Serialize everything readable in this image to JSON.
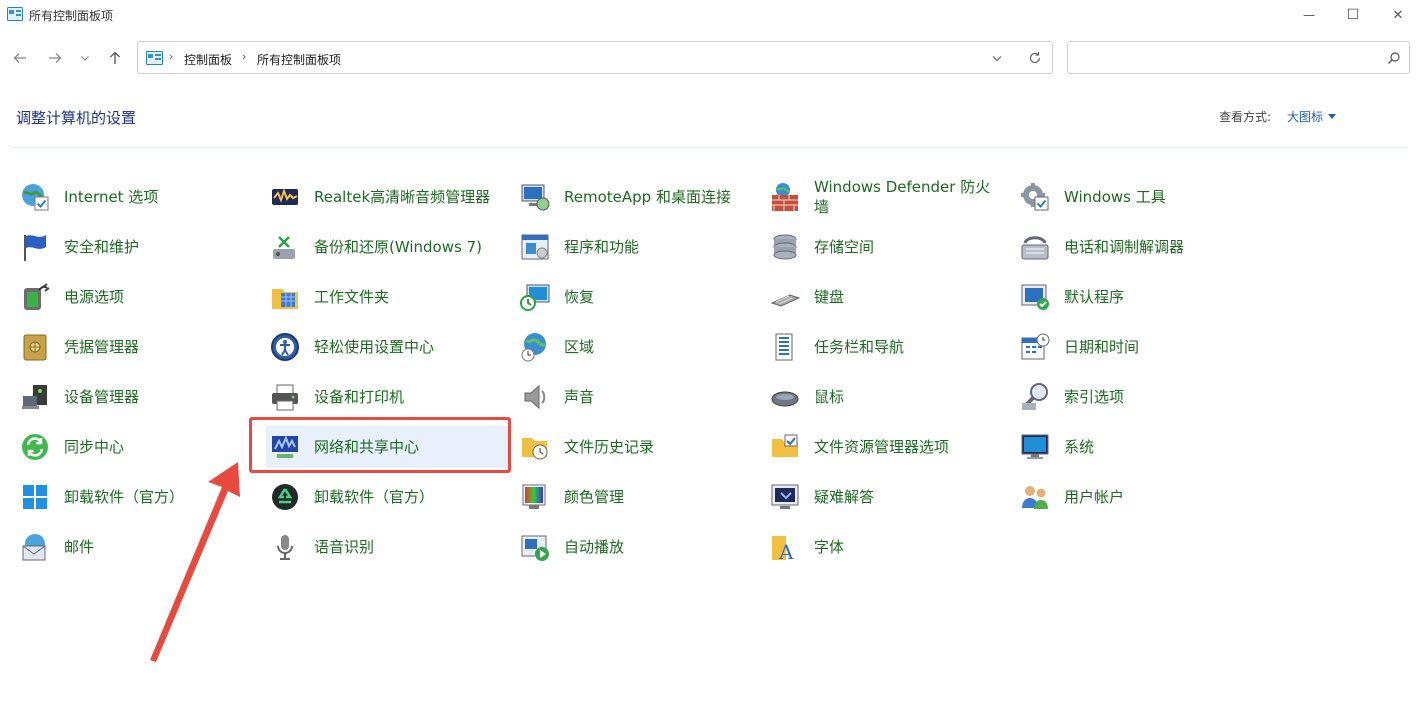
{
  "window": {
    "title": "所有控制面板项",
    "controls": {
      "minimize": "—",
      "maximize": "☐",
      "close": "✕"
    }
  },
  "nav": {
    "breadcrumb": [
      "控制面板",
      "所有控制面板项"
    ],
    "search_placeholder": ""
  },
  "header": {
    "title": "调整计算机的设置",
    "view_label": "查看方式:",
    "view_value": "大图标"
  },
  "highlight": {
    "item": "网络和共享中心",
    "color": "#e94a3f"
  },
  "items": [
    [
      "Internet 选项",
      "安全和维护",
      "电源选项",
      "凭据管理器",
      "设备管理器",
      "同步中心",
      "卸载软件（官方）",
      "邮件"
    ],
    [
      "Realtek高清晰音频管理器",
      "备份和还原(Windows 7)",
      "工作文件夹",
      "轻松使用设置中心",
      "设备和打印机",
      "网络和共享中心",
      "卸载软件（官方）",
      "语音识别"
    ],
    [
      "RemoteApp 和桌面连接",
      "程序和功能",
      "恢复",
      "区域",
      "声音",
      "文件历史记录",
      "颜色管理",
      "自动播放"
    ],
    [
      "Windows Defender 防火墙",
      "存储空间",
      "键盘",
      "任务栏和导航",
      "鼠标",
      "文件资源管理器选项",
      "疑难解答",
      "字体"
    ],
    [
      "Windows 工具",
      "电话和调制解调器",
      "默认程序",
      "日期和时间",
      "索引选项",
      "系统",
      "用户帐户"
    ]
  ],
  "icons": [
    [
      "globe-check-icon",
      "flag-icon",
      "battery-plug-icon",
      "vault-icon",
      "device-manager-icon",
      "sync-icon",
      "windows-logo-icon",
      "mail-globe-icon"
    ],
    [
      "audio-manager-icon",
      "backup-restore-icon",
      "work-folders-icon",
      "ease-of-access-icon",
      "printer-icon",
      "network-sharing-icon",
      "recycle-icon",
      "microphone-icon"
    ],
    [
      "remote-desktop-icon",
      "programs-icon",
      "recovery-icon",
      "region-globe-icon",
      "speaker-icon",
      "file-history-icon",
      "color-management-icon",
      "autoplay-icon"
    ],
    [
      "firewall-icon",
      "storage-icon",
      "keyboard-icon",
      "taskbar-icon",
      "mouse-icon",
      "folder-options-icon",
      "troubleshoot-icon",
      "fonts-icon"
    ],
    [
      "windows-tools-icon",
      "phone-modem-icon",
      "default-programs-icon",
      "calendar-clock-icon",
      "index-search-icon",
      "system-monitor-icon",
      "users-icon"
    ]
  ]
}
